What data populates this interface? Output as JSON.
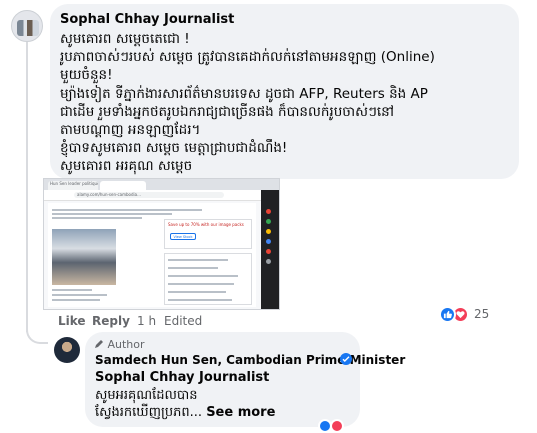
{
  "comment": {
    "author": "Sophal Chhay Journalist",
    "lines": [
      "សូមគោរព សម្តេចតេជោ !",
      "រូបភាពចាស់ៗរបស់ សម្តេច ត្រូវបានគេដាក់លក់នៅតាមអនឡាញ (Online)",
      "មួយចំនួន!",
      "ម្យ៉ាងទៀត ទីភ្នាក់ងារសារព័ត៌មានបរទេស ដូចជា AFP, Reuters និង AP",
      "ជាដើម រួមទាំងអ្នកថតរូបឯករាជ្យជាច្រើនផង ក៏បានលក់រូបចាស់ៗនៅ",
      "តាមបណ្តាញ អនឡាញដែរ។",
      "ខ្ញុំបាទសូមគោរព សម្តេច មេត្តាជ្រាបជាដំណឹង!",
      "សូមគោរព អរគុណ សម្តេច"
    ],
    "attachment": {
      "tab_label": "Hun Sen leader politique...",
      "url_text": "alamy.com/hun-sen-cambodia...",
      "promo_text": "Save up to 70% with our image packs",
      "button_label": "View Stock"
    },
    "actions": {
      "like": "Like",
      "reply": "Reply",
      "time": "1 h",
      "edited": "Edited"
    },
    "reactions": {
      "count": "25",
      "icons": [
        "like-icon",
        "love-icon"
      ]
    }
  },
  "reply": {
    "author_badge": "Author",
    "author": "Samdech Hun Sen, Cambodian Prime Minister",
    "mention": "Sophal Chhay Journalist",
    "line1": "សូមអរគុណដែលបាន",
    "line2": "ស្វែងរកឃើញប្រភព...",
    "see_more": "See more"
  },
  "colors": {
    "bubble": "#f0f2f5",
    "accent": "#1877f2",
    "love": "#f33e58",
    "meta_text": "#65676b"
  }
}
